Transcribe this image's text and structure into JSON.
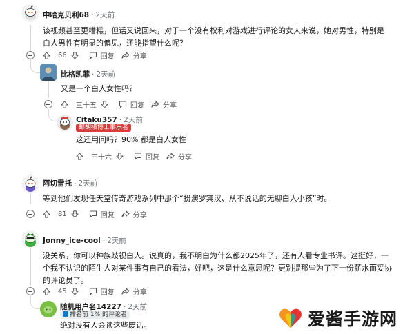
{
  "comments": [
    {
      "username": "中哈克贝利68",
      "time": "2天前",
      "body": "该视频甚至更糟糕，但话又说回来，对于一个没有权利对游戏进行评论的女人来说，她对男性，特别是白人男性有明显的偏见，还能指望什么呢？",
      "votes": "66",
      "reply_label": "回复",
      "share_label": "分享"
    },
    {
      "username": "比格凯菲",
      "time": "2天前",
      "body": "又是一个白人女性吗？",
      "votes": "三十五",
      "reply_label": "回复",
      "share_label": "分享"
    },
    {
      "username": "Citaku357",
      "time": "2天前",
      "flair": "邮胡椒博士事乐者",
      "body": "这还用问吗？90% 都是白人女性",
      "votes": "三十六",
      "reply_label": "回复",
      "share_label": "分享"
    },
    {
      "username": "阿切雷托",
      "time": "2天前",
      "body": "等到他们发现任天堂传奇游戏系列中那个“扮演罗宾汉、从不说话的无聊白人小孩”时。",
      "votes": "81",
      "reply_label": "回复",
      "share_label": "分享"
    },
    {
      "username": "Jonny_ice-cool",
      "time": "2天前",
      "body": "没关系，你可以种族歧视白人。说真的，我不明白为什么都2025年了，还有人看专业书评。这挺好，一个我不认识的陌生人对某件事有自己的看法，好吧，这是什么意思呢？更别提那些为了下一份薪水而妥协的评论员了。",
      "votes": "45",
      "reply_label": "回复",
      "share_label": "分享"
    },
    {
      "username": "随机用户名14227",
      "time": "2天前",
      "flair": "排名前 1% 的评论者",
      "body": "绝对没有人会读这些废话。"
    }
  ],
  "watermark": {
    "text": "爱酱手游网"
  },
  "colors": {
    "flair_red": "#d93a3a",
    "flair_gray_bg": "#eaedef",
    "thread_line": "#d6d9dc",
    "logo_red": "#e8322f",
    "logo_orange": "#f7941d",
    "logo_yellow": "#f6c418"
  }
}
